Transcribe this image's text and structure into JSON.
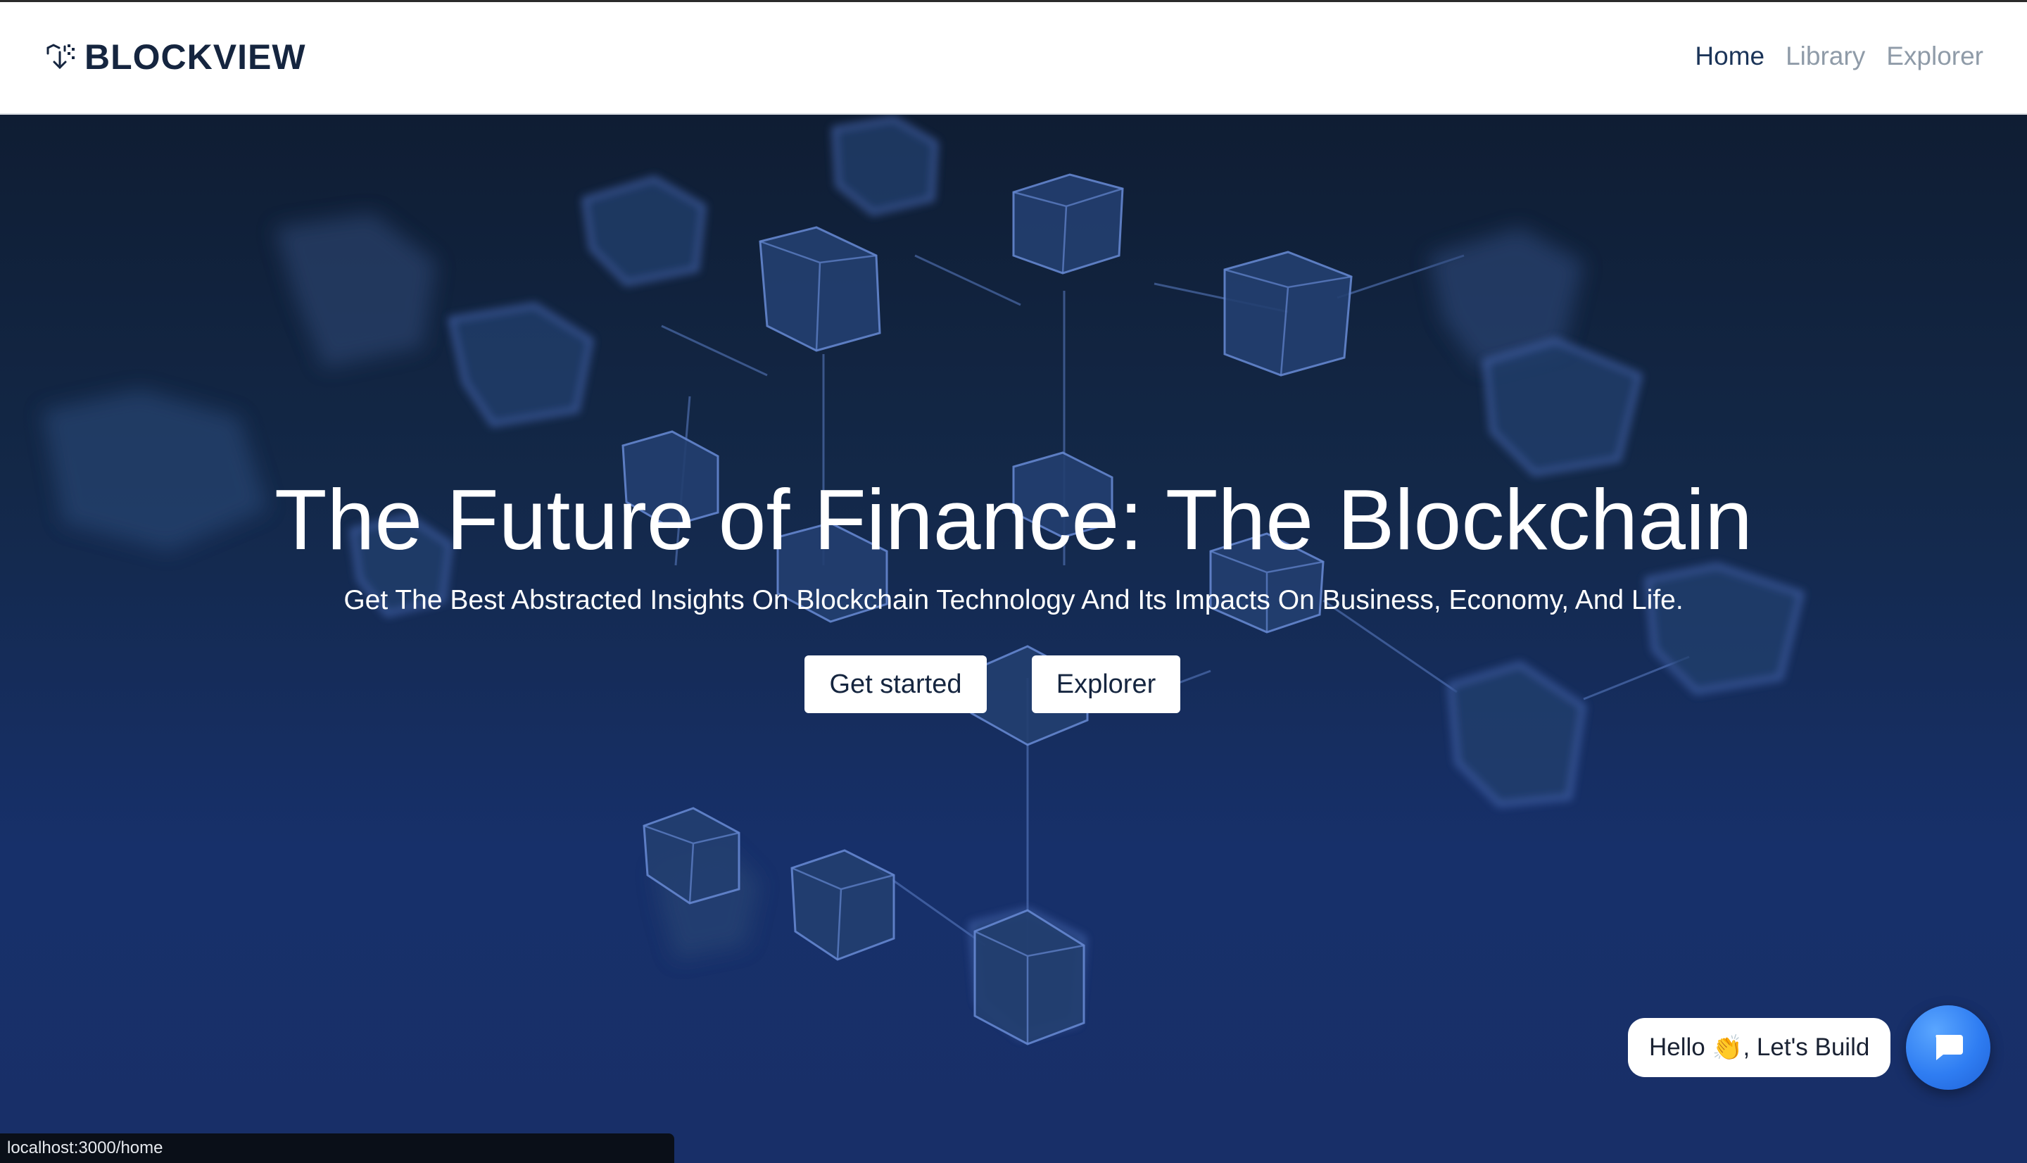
{
  "brand": {
    "name": "BLOCKVIEW",
    "icon": "blockchain-cube-icon"
  },
  "nav": {
    "home": "Home",
    "library": "Library",
    "explorer": "Explorer"
  },
  "hero": {
    "title": "The Future of Finance: The Blockchain",
    "subtitle": "Get The Best Abstracted Insights On Blockchain Technology And Its Impacts On Business, Economy, And Life.",
    "primary_button": "Get started",
    "secondary_button": "Explorer"
  },
  "chat": {
    "greeting_before": "Hello ",
    "greeting_emoji": "👏",
    "greeting_after": ", Let's Build",
    "icon": "chat-icon"
  },
  "status_bar": {
    "url": "localhost:3000/home"
  },
  "colors": {
    "brand": "#15253f",
    "nav_active": "#1b3458",
    "nav_inactive": "#8f9ba8",
    "hero_bg": "#132848",
    "chat_accent": "#2f7df2"
  }
}
